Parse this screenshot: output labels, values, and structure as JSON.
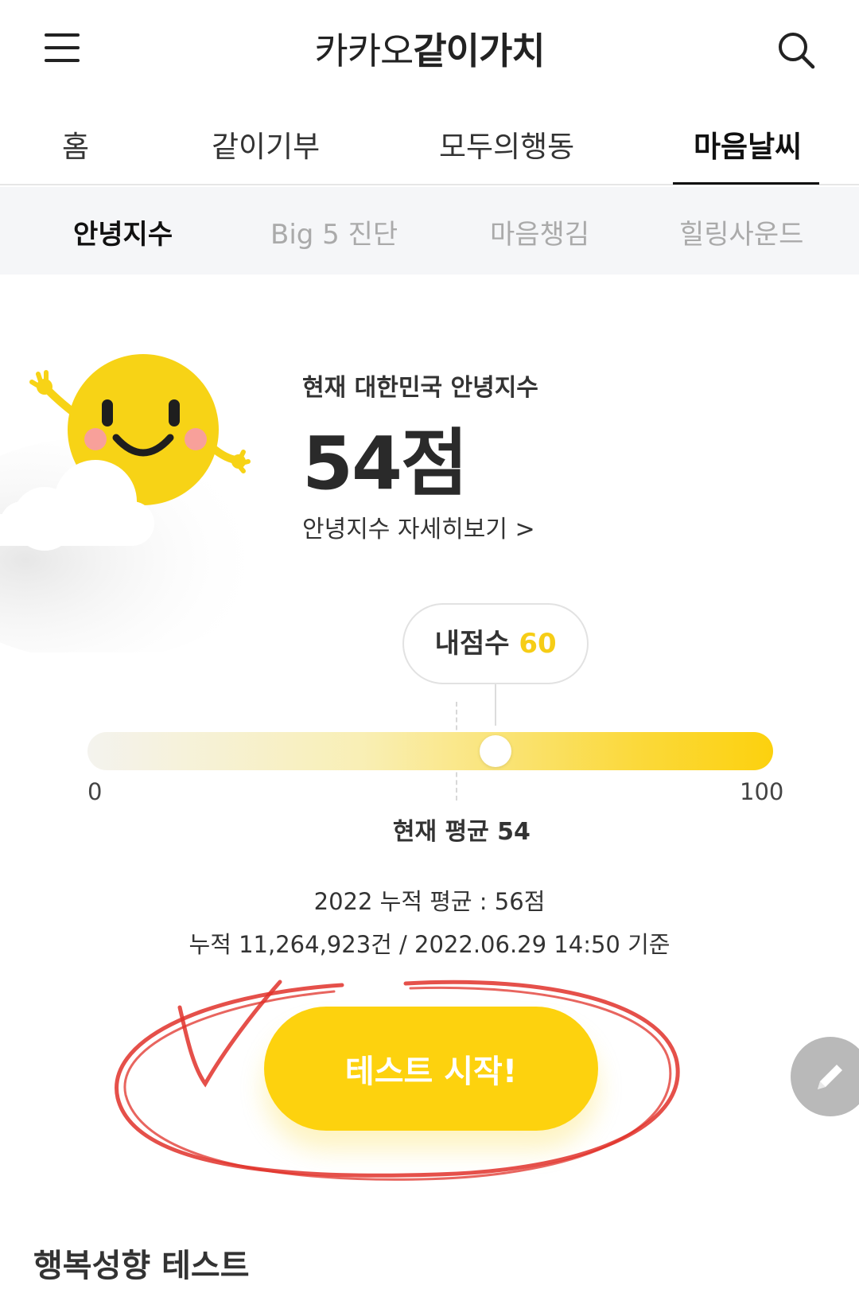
{
  "header": {
    "logo_regular": "카카오",
    "logo_bold": "같이가치"
  },
  "main_tabs": [
    {
      "label": "홈",
      "active": false
    },
    {
      "label": "같이기부",
      "active": false
    },
    {
      "label": "모두의행동",
      "active": false
    },
    {
      "label": "마음날씨",
      "active": true
    }
  ],
  "sub_tabs": [
    {
      "label": "안녕지수",
      "active": true
    },
    {
      "label": "Big 5 진단",
      "active": false
    },
    {
      "label": "마음챙김",
      "active": false
    },
    {
      "label": "힐링사운드",
      "active": false
    }
  ],
  "wellbeing": {
    "caption": "현재 대한민국 안녕지수",
    "score_text": "54점",
    "detail_link": "안녕지수 자세히보기 >"
  },
  "gauge": {
    "my_score_label": "내점수",
    "my_score": 60,
    "current_average": 54,
    "min_label": "0",
    "max_label": "100",
    "min": 0,
    "max": 100,
    "average_label": "현재 평균 54"
  },
  "stats": {
    "yearly_average": "2022 누적 평균 : 56점",
    "cumulative": "누적 11,264,923건 / 2022.06.29 14:50 기준"
  },
  "start_button_label": "테스트 시작!",
  "next_section_title": "행복성향 테스트",
  "colors": {
    "brand_yellow": "#fdd20e",
    "annotation_red": "#e0312a",
    "score_highlight": "#f6cd16"
  },
  "icons": [
    "hamburger-menu-icon",
    "search-icon",
    "smiling-sun-icon",
    "cloud-icon",
    "pencil-icon"
  ]
}
